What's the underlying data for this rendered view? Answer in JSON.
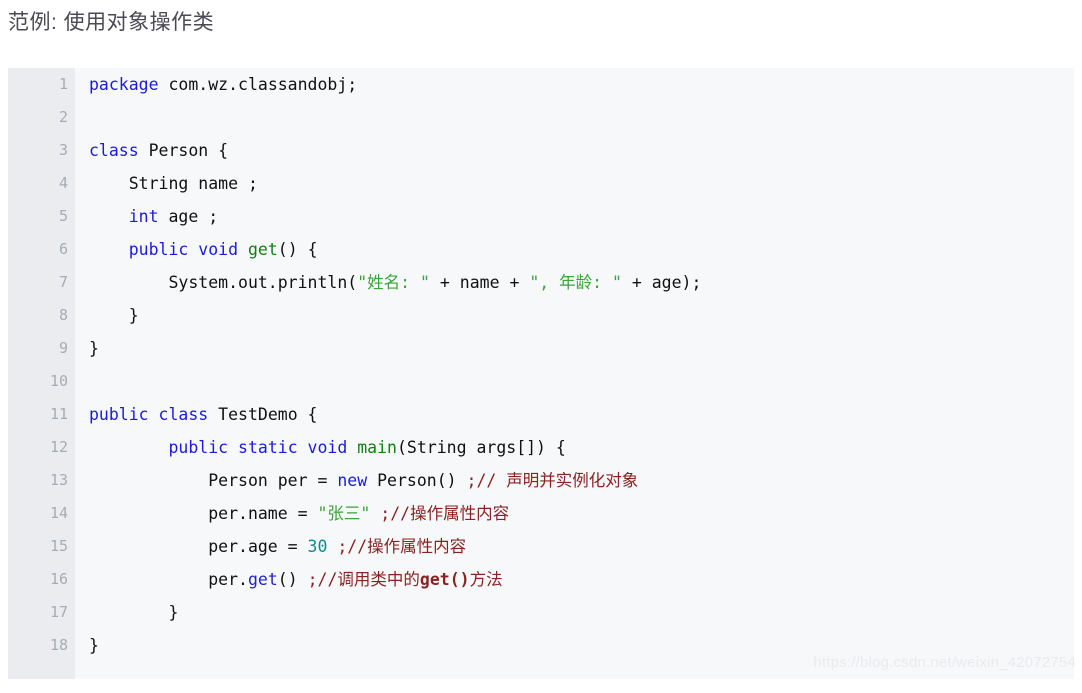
{
  "page": {
    "title": "范例: 使用对象操作类",
    "watermark": "https://blog.csdn.net/weixin_42072754",
    "colors": {
      "background": "#ffffff",
      "code_background": "#f7f8fa",
      "gutter_background": "#eaecef",
      "gutter_text": "#a6acb3",
      "title_text": "#4a4a55",
      "token_plain": "#111111",
      "token_keyword": "#1a1ae6",
      "token_function": "#108010",
      "token_string": "#3aa33a",
      "token_comment": "#8b2222",
      "token_number": "#0d8b8b",
      "token_member": "#2222cc",
      "watermark_text": "#e8ebee"
    }
  },
  "code": {
    "language": "java",
    "line_count": 18,
    "lines": [
      {
        "number": "1",
        "plain_text": "package com.wz.classandobj;",
        "tokens": [
          {
            "text": "package",
            "type": "kw"
          },
          {
            "text": " com.wz.classandobj;",
            "type": "plain"
          }
        ]
      },
      {
        "number": "2",
        "plain_text": "",
        "tokens": []
      },
      {
        "number": "3",
        "plain_text": "class Person {",
        "tokens": [
          {
            "text": "class",
            "type": "kw"
          },
          {
            "text": " Person {",
            "type": "plain"
          }
        ]
      },
      {
        "number": "4",
        "plain_text": "    String name ;",
        "tokens": [
          {
            "text": "    String name ;",
            "type": "plain"
          }
        ]
      },
      {
        "number": "5",
        "plain_text": "    int age ;",
        "tokens": [
          {
            "text": "    ",
            "type": "plain"
          },
          {
            "text": "int",
            "type": "kw"
          },
          {
            "text": " age ;",
            "type": "plain"
          }
        ]
      },
      {
        "number": "6",
        "plain_text": "    public void get() {",
        "tokens": [
          {
            "text": "    ",
            "type": "plain"
          },
          {
            "text": "public void",
            "type": "kw"
          },
          {
            "text": " ",
            "type": "plain"
          },
          {
            "text": "get",
            "type": "fn"
          },
          {
            "text": "() {",
            "type": "plain"
          }
        ]
      },
      {
        "number": "7",
        "plain_text": "        System.out.println(\"姓名: \" + name + \", 年龄: \" + age);",
        "tokens": [
          {
            "text": "        System.out.println(",
            "type": "plain"
          },
          {
            "text": "\"姓名: \"",
            "type": "str"
          },
          {
            "text": " + name + ",
            "type": "plain"
          },
          {
            "text": "\", 年龄: \"",
            "type": "str"
          },
          {
            "text": " + age);",
            "type": "plain"
          }
        ]
      },
      {
        "number": "8",
        "plain_text": "    }",
        "tokens": [
          {
            "text": "    }",
            "type": "plain"
          }
        ]
      },
      {
        "number": "9",
        "plain_text": "}",
        "tokens": [
          {
            "text": "}",
            "type": "plain"
          }
        ]
      },
      {
        "number": "10",
        "plain_text": "",
        "tokens": []
      },
      {
        "number": "11",
        "plain_text": "public class TestDemo {",
        "tokens": [
          {
            "text": "public class",
            "type": "kw"
          },
          {
            "text": " TestDemo {",
            "type": "plain"
          }
        ]
      },
      {
        "number": "12",
        "plain_text": "        public static void main(String args[]) {",
        "tokens": [
          {
            "text": "        ",
            "type": "plain"
          },
          {
            "text": "public static void",
            "type": "kw"
          },
          {
            "text": " ",
            "type": "plain"
          },
          {
            "text": "main",
            "type": "fn"
          },
          {
            "text": "(String args[]) {",
            "type": "plain"
          }
        ]
      },
      {
        "number": "13",
        "plain_text": "            Person per = new Person() ;// 声明并实例化对象",
        "tokens": [
          {
            "text": "            Person per = ",
            "type": "plain"
          },
          {
            "text": "new",
            "type": "kw"
          },
          {
            "text": " Person() ",
            "type": "plain"
          },
          {
            "text": ";// 声明并实例化对象",
            "type": "comment"
          }
        ]
      },
      {
        "number": "14",
        "plain_text": "            per.name = \"张三\" ;//操作属性内容",
        "tokens": [
          {
            "text": "            per.name = ",
            "type": "plain"
          },
          {
            "text": "\"张三\"",
            "type": "str"
          },
          {
            "text": " ",
            "type": "plain"
          },
          {
            "text": ";//操作属性内容",
            "type": "comment"
          }
        ]
      },
      {
        "number": "15",
        "plain_text": "            per.age = 30 ;//操作属性内容",
        "tokens": [
          {
            "text": "            per.age = ",
            "type": "plain"
          },
          {
            "text": "30",
            "type": "num"
          },
          {
            "text": " ",
            "type": "plain"
          },
          {
            "text": ";//操作属性内容",
            "type": "comment"
          }
        ]
      },
      {
        "number": "16",
        "plain_text": "            per.get() ;//调用类中的get()方法",
        "tokens": [
          {
            "text": "            per.",
            "type": "plain"
          },
          {
            "text": "get",
            "type": "ref"
          },
          {
            "text": "() ",
            "type": "plain"
          },
          {
            "text": ";//调用类中的",
            "type": "comment"
          },
          {
            "text": "get()",
            "type": "comment-b"
          },
          {
            "text": "方法",
            "type": "comment"
          }
        ]
      },
      {
        "number": "17",
        "plain_text": "        }",
        "tokens": [
          {
            "text": "        }",
            "type": "plain"
          }
        ]
      },
      {
        "number": "18",
        "plain_text": "}",
        "tokens": [
          {
            "text": "}",
            "type": "plain"
          }
        ]
      }
    ]
  }
}
